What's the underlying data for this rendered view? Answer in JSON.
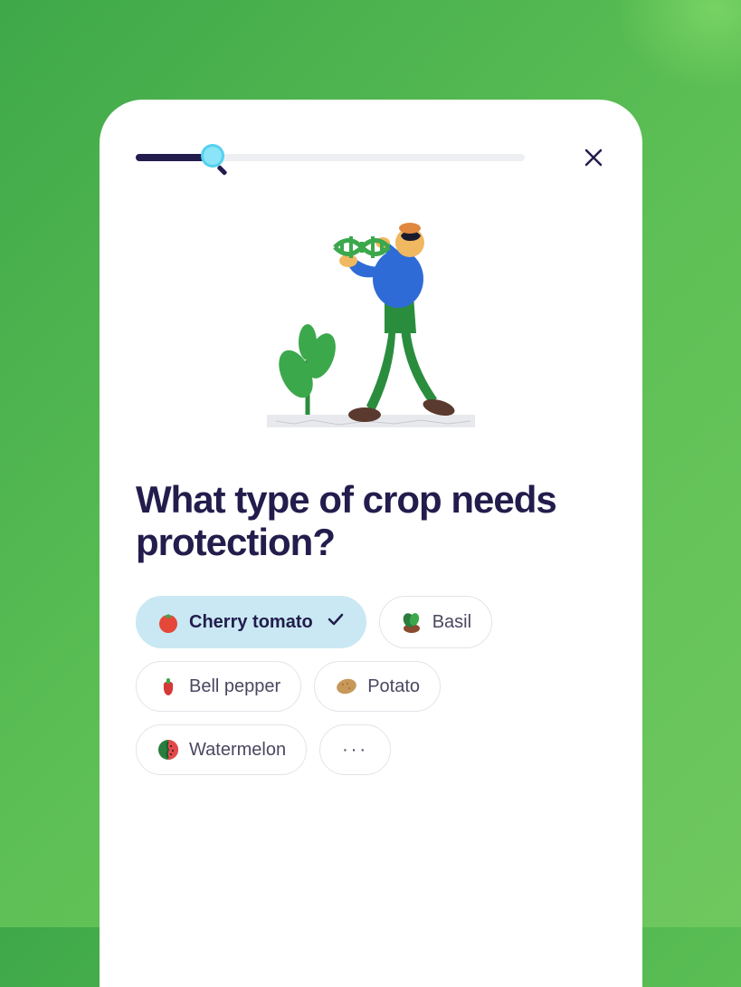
{
  "question": "What type of crop needs protection?",
  "progress": {
    "percent": 19
  },
  "options": [
    {
      "id": "cherry-tomato",
      "label": "Cherry tomato",
      "selected": true
    },
    {
      "id": "basil",
      "label": "Basil",
      "selected": false
    },
    {
      "id": "bell-pepper",
      "label": "Bell pepper",
      "selected": false
    },
    {
      "id": "potato",
      "label": "Potato",
      "selected": false
    },
    {
      "id": "watermelon",
      "label": "Watermelon",
      "selected": false
    }
  ],
  "more": "···"
}
